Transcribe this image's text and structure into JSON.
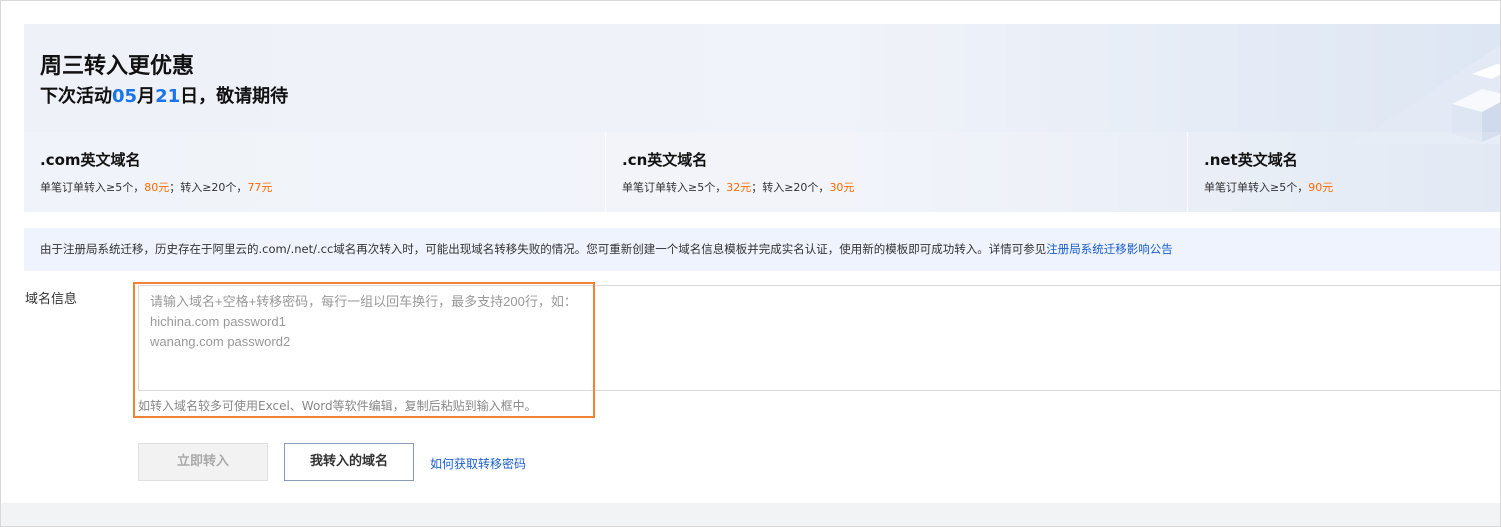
{
  "banner": {
    "title": "周三转入更优惠",
    "sub_prefix": "下次活动",
    "month": "05",
    "month_unit": "月",
    "day": "21",
    "sub_suffix": "日，敬请期待"
  },
  "cards": [
    {
      "title": ".com英文域名",
      "desc_1": "单笔订单转入≥5个，",
      "price_1": "80元",
      "desc_2": "；转入≥20个，",
      "price_2": "77元"
    },
    {
      "title": ".cn英文域名",
      "desc_1": "单笔订单转入≥5个，",
      "price_1": "32元",
      "desc_2": "；转入≥20个，",
      "price_2": "30元"
    },
    {
      "title": ".net英文域名",
      "desc_1": "单笔订单转入≥5个，",
      "price_1": "90元"
    }
  ],
  "notice": {
    "text": "由于注册局系统迁移，历史存在于阿里云的.com/.net/.cc域名再次转入时，可能出现域名转移失败的情况。您可重新创建一个域名信息模板并完成实名认证，使用新的模板即可成功转入。详情可参见",
    "link": "注册局系统迁移影响公告"
  },
  "form": {
    "label": "域名信息",
    "placeholder": "请输入域名+空格+转移密码，每行一组以回车换行，最多支持200行，如：\nhichina.com password1\nwanang.com password2",
    "value": "",
    "hint": "如转入域名较多可使用Excel、Word等软件编辑，复制后粘贴到输入框中。"
  },
  "actions": {
    "transfer_now": "立即转入",
    "my_transfers": "我转入的域名",
    "help_link": "如何获取转移密码"
  },
  "colors": {
    "accent_blue": "#1a73e8",
    "price_orange": "#ff6a00",
    "link_blue": "#1a5fcf",
    "highlight_orange": "#ee8434"
  }
}
